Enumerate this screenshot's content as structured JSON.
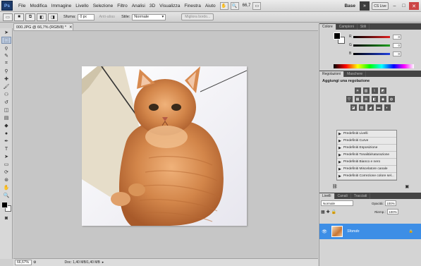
{
  "menubar": {
    "logo": "Ps",
    "items": [
      "File",
      "Modifica",
      "Immagine",
      "Livello",
      "Selezione",
      "Filtro",
      "Analisi",
      "3D",
      "Visualizza",
      "Finestra",
      "Aiuto"
    ],
    "zoom": "66,7",
    "workspace": "Base",
    "more": "»",
    "cs_live": "CS Live"
  },
  "options": {
    "sfuma_label": "Sfuma:",
    "sfuma_value": "0 px",
    "antialias_label": "Anti-alias",
    "stile_label": "Stile:",
    "stile_value": "Normale",
    "migliora_label": "Migliora bordo..."
  },
  "document": {
    "tab_title": "000.JPG @ 66,7% (RGB/8) *",
    "zoom": "66,67%",
    "info": "Doc: 1,40 MB/1,40 MB"
  },
  "color_panel": {
    "tabs": [
      "Colore",
      "Campioni",
      "Stili"
    ],
    "channels": [
      {
        "label": "R",
        "value": "0",
        "color": "#e02020"
      },
      {
        "label": "G",
        "value": "0",
        "color": "#20a020"
      },
      {
        "label": "B",
        "value": "0",
        "color": "#2040e0"
      }
    ]
  },
  "adjustments": {
    "tabs": [
      "Regolazioni",
      "Maschere"
    ],
    "title": "Aggiungi una regolazione",
    "presets": [
      "Predefiniti Livelli",
      "Predefiniti Curve",
      "Predefiniti Esposizione",
      "Predefiniti Tonalità/saturazione",
      "Predefiniti Bianco e nero",
      "Predefiniti Miscelatore canale",
      "Predefiniti Correzione colore sel..."
    ]
  },
  "layers": {
    "tabs": [
      "Livelli",
      "Canali",
      "Tracciati"
    ],
    "blend_mode": "Normale",
    "opacity_label": "Opacità:",
    "opacity_value": "100%",
    "fill_label": "Riemp.:",
    "fill_value": "100%",
    "layer_name": "Sfondo"
  },
  "accent_color": "#3d8ee6"
}
